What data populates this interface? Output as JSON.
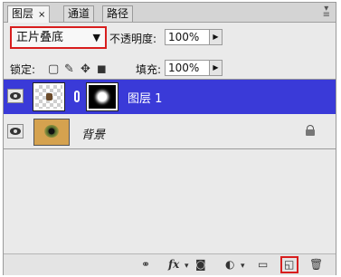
{
  "tabs": [
    {
      "label": "图层",
      "close": "×"
    },
    {
      "label": "通道"
    },
    {
      "label": "路径"
    }
  ],
  "panel_menu_icon": "panel-menu-icon",
  "blend": {
    "mode": "正片叠底"
  },
  "opacity": {
    "label": "不透明度:",
    "value": "100%"
  },
  "lock": {
    "label": "锁定:"
  },
  "fill": {
    "label": "填充:",
    "value": "100%"
  },
  "layers": [
    {
      "name": "图层 1",
      "selected": true
    },
    {
      "name": "背景",
      "locked": true
    }
  ],
  "footer": {
    "fx_label": "fx"
  },
  "colors": {
    "selection": "#3a3ad8",
    "highlight_box": "#d81e1e"
  }
}
